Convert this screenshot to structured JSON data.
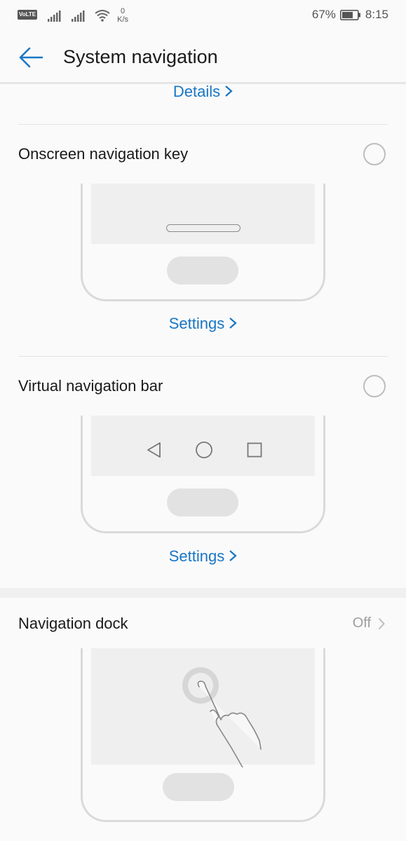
{
  "status_bar": {
    "volte": "VoLTE",
    "net_speed_value": "0",
    "net_speed_unit": "K/s",
    "battery": "67%",
    "time": "8:15"
  },
  "header": {
    "title": "System navigation"
  },
  "sections": {
    "top_link": "Details",
    "onscreen_key": {
      "title": "Onscreen navigation key",
      "link": "Settings"
    },
    "virtual_bar": {
      "title": "Virtual navigation bar",
      "link": "Settings"
    },
    "dock": {
      "title": "Navigation dock",
      "value": "Off"
    }
  },
  "colors": {
    "accent": "#1976c4",
    "background": "#fafafa"
  }
}
